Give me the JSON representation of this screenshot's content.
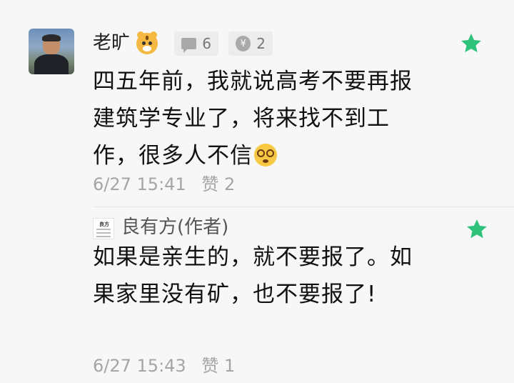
{
  "comments": [
    {
      "username": "老旷",
      "badge_icon": "tiger-icon",
      "message_count": "6",
      "coin_symbol": "¥",
      "coin_count": "2",
      "text": "四五年前，我就说高考不要再报建筑学专业了，将来找不到工作，很多人不信",
      "emoji_icon": "dizzy-face-icon",
      "time": "6/27 15:41",
      "like_label": "赞 2",
      "starred": true
    },
    {
      "username": "良有方(作者)",
      "logo_text": "良方",
      "text": "如果是亲生的，就不要报了。如果家里没有矿，也不要报了!",
      "time": "6/27 15:43",
      "like_label": "赞 1",
      "starred": true
    }
  ],
  "colors": {
    "star": "#2fc27a",
    "meta_text": "#a5a5a5",
    "background": "#f7f7f7"
  }
}
